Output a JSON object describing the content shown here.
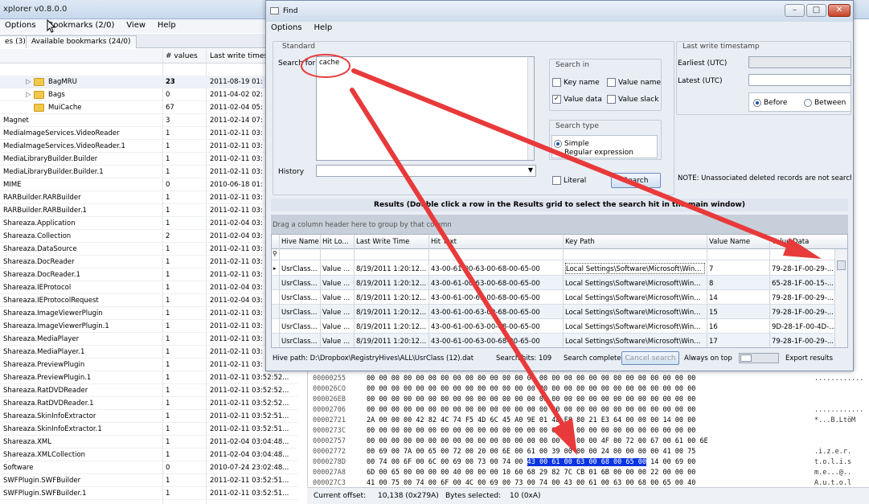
{
  "main": {
    "title_fragment": "xplorer v0.8.0.0",
    "menu": [
      "Options",
      "Bookmarks (2/0)",
      "View",
      "Help"
    ],
    "tabs": [
      "es (3)",
      "Available bookmarks (24/0)"
    ],
    "tree_header": {
      "values": "# values",
      "time": "Last write times"
    },
    "tree_rows": [
      {
        "name": "BagMRU",
        "count": "23",
        "time": "2011-08-19 01:",
        "folder": true,
        "expand": true,
        "bold": true
      },
      {
        "name": "Bags",
        "count": "0",
        "time": "2011-04-02 02:",
        "folder": true,
        "expand": true
      },
      {
        "name": "MuiCache",
        "count": "67",
        "time": "2011-02-04 05:",
        "folder": true
      },
      {
        "name": "Magnet",
        "count": "3",
        "time": "2011-02-14 07:"
      },
      {
        "name": "MediaImageServices.VideoReader",
        "count": "1",
        "time": "2011-02-11 03:"
      },
      {
        "name": "MediaImageServices.VideoReader.1",
        "count": "1",
        "time": "2011-02-11 03:"
      },
      {
        "name": "MediaLibraryBuilder.Builder",
        "count": "1",
        "time": "2011-02-11 03:"
      },
      {
        "name": "MediaLibraryBuilder.Builder.1",
        "count": "1",
        "time": "2011-02-11 03:"
      },
      {
        "name": "MIME",
        "count": "0",
        "time": "2010-06-18 01:"
      },
      {
        "name": "RARBuilder.RARBuilder",
        "count": "1",
        "time": "2011-02-11 03:"
      },
      {
        "name": "RARBuilder.RARBuilder.1",
        "count": "1",
        "time": "2011-02-11 03:"
      },
      {
        "name": "Shareaza.Application",
        "count": "1",
        "time": "2011-02-04 03:"
      },
      {
        "name": "Shareaza.Collection",
        "count": "2",
        "time": "2011-02-04 03:"
      },
      {
        "name": "Shareaza.DataSource",
        "count": "1",
        "time": "2011-02-11 03:"
      },
      {
        "name": "Shareaza.DocReader",
        "count": "1",
        "time": "2011-02-11 03:"
      },
      {
        "name": "Shareaza.DocReader.1",
        "count": "1",
        "time": "2011-02-11 03:"
      },
      {
        "name": "Shareaza.IEProtocol",
        "count": "1",
        "time": "2011-02-04 03:"
      },
      {
        "name": "Shareaza.IEProtocolRequest",
        "count": "1",
        "time": "2011-02-04 03:"
      },
      {
        "name": "Shareaza.ImageViewerPlugin",
        "count": "1",
        "time": "2011-02-11 03:"
      },
      {
        "name": "Shareaza.ImageViewerPlugin.1",
        "count": "1",
        "time": "2011-02-11 03:"
      },
      {
        "name": "Shareaza.MediaPlayer",
        "count": "1",
        "time": "2011-02-11 03:"
      },
      {
        "name": "Shareaza.MediaPlayer.1",
        "count": "1",
        "time": "2011-02-11 03:"
      },
      {
        "name": "Shareaza.PreviewPlugin",
        "count": "1",
        "time": "2011-02-11 03:"
      },
      {
        "name": "Shareaza.PreviewPlugin.1",
        "count": "1",
        "time": "2011-02-11 03:52:52..."
      },
      {
        "name": "Shareaza.RatDVDReader",
        "count": "1",
        "time": "2011-02-11 03:52:52..."
      },
      {
        "name": "Shareaza.RatDVDReader.1",
        "count": "1",
        "time": "2011-02-11 03:52:52..."
      },
      {
        "name": "Shareaza.SkinInfoExtractor",
        "count": "1",
        "time": "2011-02-11 03:52:51..."
      },
      {
        "name": "Shareaza.SkinInfoExtractor.1",
        "count": "1",
        "time": "2011-02-11 03:52:51..."
      },
      {
        "name": "Shareaza.XML",
        "count": "1",
        "time": "2011-02-04 03:04:48..."
      },
      {
        "name": "Shareaza.XMLCollection",
        "count": "1",
        "time": "2011-02-04 03:04:48..."
      },
      {
        "name": "Software",
        "count": "0",
        "time": "2010-07-24 23:02:48..."
      },
      {
        "name": "SWFPlugin.SWFBuilder",
        "count": "1",
        "time": "2011-02-11 03:52:51..."
      },
      {
        "name": "SWFPlugin.SWFBuilder.1",
        "count": "1",
        "time": "2011-02-11 03:52:51..."
      }
    ]
  },
  "hex": {
    "rows": [
      {
        "off": "00000255",
        "bytes": "00 00 00 00 00 00 00 00 00 00 00 00 00 00 00 00 00 00 00 00 00 00 00 00 00 00 00",
        "ascii": "............"
      },
      {
        "off": "000026CO",
        "bytes": "00 00 00 00 00 00 00 00 00 00 00 00 00 00 00 00 00 00 00 00 00 00 00 00 00 00 00",
        "ascii": ""
      },
      {
        "off": "000026EB",
        "bytes": "00 00 00 00 00 00 00 00 00 00 00 00 00 00 00 00 00 00 00 00 00 00 00 00 00 00 00",
        "ascii": ""
      },
      {
        "off": "00002706",
        "bytes": "00 00 00 00 00 00 00 00 00 00 00 00 00 00 00 00 00 00 00 00 00 00 00 00 00 00 00",
        "ascii": "............"
      },
      {
        "off": "00002721",
        "bytes": "2A 00 00 00 42 82 4C 74 F5 4D 6C 45 A0 9E 01 4E F8 80 21 E3 64 00 00 00 14 00 00",
        "ascii": "*...B.LtöM"
      },
      {
        "off": "0000273C",
        "bytes": "00 00 00 00 00 00 00 00 00 00 00 00 00 00 00 00 00 00 00 00 00 00 00 00 00 00 00",
        "ascii": ""
      },
      {
        "off": "00002757",
        "bytes": "00 00 00 00 00 00 00 00 00 00 00 00 00 00 00 00 00 00 00 4F 00 72 00 67 00 61 00 6E",
        "ascii": ""
      },
      {
        "off": "00002772",
        "bytes": "00 69 00 7A 00 65 00 72 00 20 00 6E 00 61 00 39 00 00 00 24 00 00 00 00 41 00 75",
        "ascii": ".i.z.e.r."
      },
      {
        "off": "0000278D",
        "pre": "00 74 00 6F 00 6C 00 69 00 73 00 74 00 ",
        "sel": "43 00 61 00 63 00 68 00 65 00",
        "post": " 14 00 69 00",
        "ascii": "t.o.l.i.s"
      },
      {
        "off": "000027A8",
        "bytes": "6D 00 65 00 00 00 00 40 00 00 00 10 60 68 29 82 7C CB 01 6B 00 00 00 22 00 00 00",
        "ascii": "m.e...@.."
      },
      {
        "off": "000027C3",
        "bytes": "41 00 75 00 74 00 6F 00 4C 00 69 00 73 00 74 00 43 00 61 00 63 00 68 00 65 00 40",
        "ascii": "A.u.t.o.l"
      }
    ],
    "status": {
      "offset_label": "Current offset:",
      "offset_value": "10,138 (0x279A)",
      "selected_label": "Bytes selected:",
      "selected_value": "10 (0xA)"
    }
  },
  "find": {
    "title": "Find",
    "menu": [
      "Options",
      "Help"
    ],
    "standard_label": "Standard",
    "search_for_label": "Search for",
    "search_text": "cache",
    "history_label": "History",
    "search_in_label": "Search in",
    "search_in": [
      {
        "label": "Key name",
        "checked": false
      },
      {
        "label": "Value name",
        "checked": false
      },
      {
        "label": "Value data",
        "checked": true
      },
      {
        "label": "Value slack",
        "checked": false
      }
    ],
    "search_type_label": "Search type",
    "search_types": [
      {
        "label": "Simple",
        "selected": true
      },
      {
        "label": "Regular expression",
        "selected": false
      }
    ],
    "literal_label": "Literal",
    "search_button": "Search",
    "lwt_label": "Last write timestamp",
    "earliest_label": "Earliest (UTC)",
    "latest_label": "Latest (UTC)",
    "before_label": "Before",
    "between_label": "Between",
    "note": "NOTE: Unassociated deleted records are not searche",
    "results_title": "Results (Double click a row in the Results grid to select the search hit in the main window)",
    "group_hint": "Drag a column header here to group by that column",
    "columns": [
      "Hive Name",
      "Hit Lo...",
      "Last Write Time",
      "Hit Text",
      "Key Path",
      "Value Name",
      "Value Data"
    ],
    "rows": [
      {
        "hive": "UsrClass...",
        "hit": "Value ...",
        "time": "8/19/2011 1:20:12...",
        "text": "43-00-61-00-63-00-68-00-65-00",
        "path": "Local Settings\\Software\\Microsoft\\Win...",
        "vname": "7",
        "vdata": "79-28-1F-00-29-..."
      },
      {
        "hive": "UsrClass...",
        "hit": "Value ...",
        "time": "8/19/2011 1:20:12...",
        "text": "43-00-61-00-63-00-68-00-65-00",
        "path": "Local Settings\\Software\\Microsoft\\Win...",
        "vname": "8",
        "vdata": "65-28-1F-00-15-..."
      },
      {
        "hive": "UsrClass...",
        "hit": "Value ...",
        "time": "8/19/2011 1:20:12...",
        "text": "43-00-61-00-63-00-68-00-65-00",
        "path": "Local Settings\\Software\\Microsoft\\Win...",
        "vname": "14",
        "vdata": "79-28-1F-00-29-..."
      },
      {
        "hive": "UsrClass...",
        "hit": "Value ...",
        "time": "8/19/2011 1:20:12...",
        "text": "43-00-61-00-63-00-68-00-65-00",
        "path": "Local Settings\\Software\\Microsoft\\Win...",
        "vname": "15",
        "vdata": "79-28-1F-00-29-..."
      },
      {
        "hive": "UsrClass...",
        "hit": "Value ...",
        "time": "8/19/2011 1:20:12...",
        "text": "43-00-61-00-63-00-68-00-65-00",
        "path": "Local Settings\\Software\\Microsoft\\Win...",
        "vname": "16",
        "vdata": "9D-28-1F-00-4D-..."
      },
      {
        "hive": "UsrClass...",
        "hit": "Value ...",
        "time": "8/19/2011 1:20:12...",
        "text": "43-00-61-00-63-00-68-00-65-00",
        "path": "Local Settings\\Software\\Microsoft\\Win...",
        "vname": "17",
        "vdata": "79-28-1F-00-29-..."
      }
    ],
    "status": {
      "hive_path": "Hive path: D:\\Dropbox\\RegistryHives\\ALL\\UsrClass (12).dat",
      "hits": "Search hits: 109",
      "complete": "Search complete",
      "cancel": "Cancel search",
      "always_on_top": "Always on top",
      "export": "Export results"
    }
  },
  "colors": {
    "accent": "#1d4fa8",
    "selection": "#0b35e0",
    "annotation": "#e83a3a"
  },
  "icons": [
    "folder-icon",
    "expand-triangle-icon",
    "window-icon",
    "minimize-icon",
    "maximize-icon",
    "close-icon",
    "dropdown-arrow-icon",
    "row-pointer-icon",
    "filter-icon",
    "mouse-cursor-icon"
  ]
}
